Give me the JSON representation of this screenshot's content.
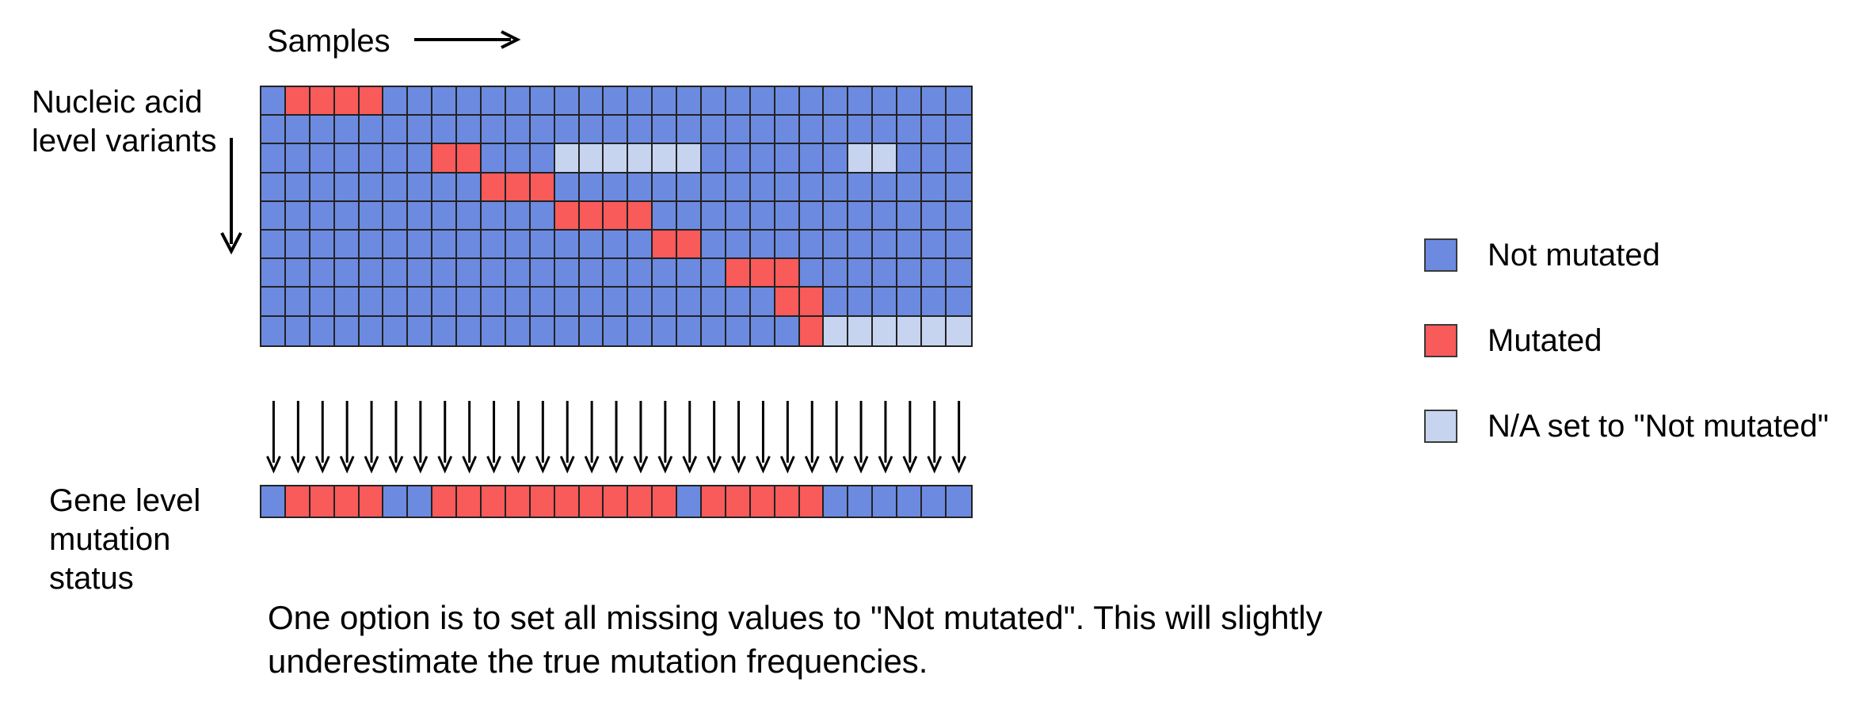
{
  "header": {
    "samples_label": "Samples",
    "samples_arrow_icon": "arrow-right-icon"
  },
  "labels": {
    "nucleic_acid_level_variants": "Nucleic acid level variants",
    "gene_level_mutation_status": "Gene level mutation status",
    "down_arrow_icon": "arrow-down-icon"
  },
  "legend": {
    "items": [
      {
        "label": "Not mutated",
        "color": "#6c8ae0",
        "state": "not_mutated"
      },
      {
        "label": "Mutated",
        "color": "#f95a5a",
        "state": "mutated"
      },
      {
        "label": "N/A set to \"Not mutated\"",
        "color": "#c7d4ef",
        "state": "na_set_not_mutated"
      }
    ]
  },
  "caption": {
    "text": "One option is to set all missing values to \"Not mutated\". This will slightly underestimate the true mutation frequencies."
  },
  "colors": {
    "not_mutated": "#6c8ae0",
    "mutated": "#f95a5a",
    "na": "#c7d4ef",
    "grid_line": "#222222",
    "text": "#000000",
    "background": "#ffffff"
  },
  "chart_data": {
    "type": "heatmap",
    "title": "",
    "xlabel": "Samples",
    "ylabel": "Nucleic acid level variants",
    "n_columns": 29,
    "n_rows": 9,
    "value_legend": {
      "0": "Not mutated",
      "1": "Mutated",
      "2": "N/A set to \"Not mutated\""
    },
    "matrix": [
      [
        0,
        1,
        1,
        1,
        1,
        0,
        0,
        0,
        0,
        0,
        0,
        0,
        0,
        0,
        0,
        0,
        0,
        0,
        0,
        0,
        0,
        0,
        0,
        0,
        0,
        0,
        0,
        0,
        0
      ],
      [
        0,
        0,
        0,
        0,
        0,
        0,
        0,
        0,
        0,
        0,
        0,
        0,
        0,
        0,
        0,
        0,
        0,
        0,
        0,
        0,
        0,
        0,
        0,
        0,
        0,
        0,
        0,
        0,
        0
      ],
      [
        0,
        0,
        0,
        0,
        0,
        0,
        0,
        1,
        1,
        0,
        0,
        0,
        2,
        2,
        2,
        2,
        2,
        2,
        0,
        0,
        0,
        0,
        0,
        0,
        2,
        2,
        0,
        0,
        0
      ],
      [
        0,
        0,
        0,
        0,
        0,
        0,
        0,
        0,
        0,
        1,
        1,
        1,
        0,
        0,
        0,
        0,
        0,
        0,
        0,
        0,
        0,
        0,
        0,
        0,
        0,
        0,
        0,
        0,
        0
      ],
      [
        0,
        0,
        0,
        0,
        0,
        0,
        0,
        0,
        0,
        0,
        0,
        0,
        1,
        1,
        1,
        1,
        0,
        0,
        0,
        0,
        0,
        0,
        0,
        0,
        0,
        0,
        0,
        0,
        0
      ],
      [
        0,
        0,
        0,
        0,
        0,
        0,
        0,
        0,
        0,
        0,
        0,
        0,
        0,
        0,
        0,
        0,
        1,
        1,
        0,
        0,
        0,
        0,
        0,
        0,
        0,
        0,
        0,
        0,
        0
      ],
      [
        0,
        0,
        0,
        0,
        0,
        0,
        0,
        0,
        0,
        0,
        0,
        0,
        0,
        0,
        0,
        0,
        0,
        0,
        0,
        1,
        1,
        1,
        0,
        0,
        0,
        0,
        0,
        0,
        0
      ],
      [
        0,
        0,
        0,
        0,
        0,
        0,
        0,
        0,
        0,
        0,
        0,
        0,
        0,
        0,
        0,
        0,
        0,
        0,
        0,
        0,
        0,
        1,
        1,
        0,
        0,
        0,
        0,
        0,
        0
      ],
      [
        0,
        0,
        0,
        0,
        0,
        0,
        0,
        0,
        0,
        0,
        0,
        0,
        0,
        0,
        0,
        0,
        0,
        0,
        0,
        0,
        0,
        0,
        1,
        2,
        2,
        2,
        2,
        2,
        2
      ]
    ],
    "gene_level_row": [
      0,
      1,
      1,
      1,
      1,
      0,
      0,
      1,
      1,
      1,
      1,
      1,
      1,
      1,
      1,
      1,
      1,
      0,
      1,
      1,
      1,
      1,
      1,
      0,
      0,
      0,
      0,
      0,
      0
    ],
    "arrow_count": 29
  }
}
